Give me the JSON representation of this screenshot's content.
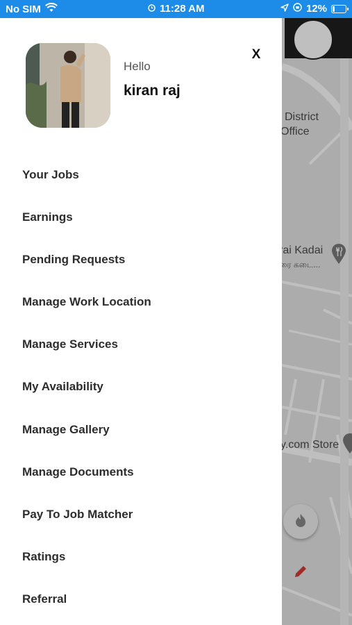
{
  "status_bar": {
    "carrier": "No SIM",
    "time": "11:28 AM",
    "battery": "12%",
    "icons": [
      "wifi-icon",
      "alarm-icon",
      "location-arrow-icon",
      "orientation-lock-icon",
      "battery-charging-icon"
    ],
    "background_color": "#1c8ce8"
  },
  "drawer": {
    "greeting": "Hello",
    "user_name": "kiran raj",
    "close_label": "X",
    "menu_items": [
      {
        "label": "Your Jobs"
      },
      {
        "label": "Earnings"
      },
      {
        "label": "Pending Requests"
      },
      {
        "label": "Manage Work Location"
      },
      {
        "label": "Manage Services"
      },
      {
        "label": "My Availability"
      },
      {
        "label": "Manage Gallery"
      },
      {
        "label": "Manage Documents"
      },
      {
        "label": "Pay To Job Matcher"
      },
      {
        "label": "Ratings"
      },
      {
        "label": "Referral"
      }
    ]
  },
  "map": {
    "labels": [
      "District",
      "Office",
      "rai Kadai",
      "ரை கடை...",
      "y.com Store"
    ],
    "icons": [
      "restaurant-pin-icon",
      "map-pin-icon",
      "fire-icon",
      "pencil-icon"
    ],
    "accent_color": "#e03030"
  }
}
